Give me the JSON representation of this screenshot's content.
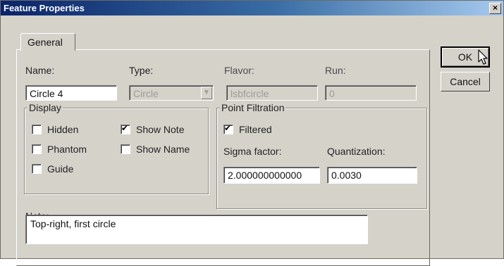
{
  "window": {
    "title": "Feature Properties",
    "close_glyph": "×"
  },
  "tabs": [
    {
      "label": "General"
    }
  ],
  "buttons": {
    "ok": "OK",
    "cancel": "Cancel"
  },
  "fields": {
    "name": {
      "label": "Name:",
      "value": "Circle 4"
    },
    "type": {
      "label": "Type:",
      "value": "Circle",
      "arrow": "▼"
    },
    "flavor": {
      "label": "Flavor:",
      "value": "lsbfcircle"
    },
    "run": {
      "label": "Run:",
      "value": "0"
    }
  },
  "display": {
    "legend": "Display",
    "options": [
      {
        "label": "Hidden",
        "checked": false
      },
      {
        "label": "Phantom",
        "checked": false
      },
      {
        "label": "Guide",
        "checked": false
      },
      {
        "label": "Show Note",
        "checked": true
      },
      {
        "label": "Show Name",
        "checked": false
      }
    ]
  },
  "point_filtration": {
    "legend": "Point Filtration",
    "filtered": {
      "label": "Filtered",
      "checked": true
    },
    "sigma": {
      "label": "Sigma factor:",
      "value": "2.000000000000"
    },
    "quantization": {
      "label": "Quantization:",
      "value": "0.0030"
    }
  },
  "note": {
    "label": "Note:",
    "value": "Top-right, first circle"
  },
  "icons": {
    "close": "close-icon",
    "cursor": "arrow-cursor-icon",
    "dropdown": "chevron-down-icon",
    "check": "checkmark-icon"
  }
}
